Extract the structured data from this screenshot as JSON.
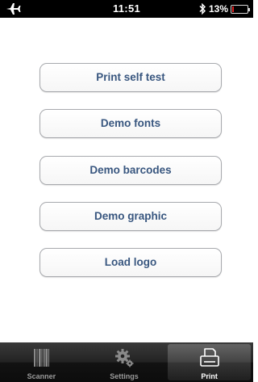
{
  "status_bar": {
    "time": "11:51",
    "battery_percent": "13%",
    "icons": [
      "airplane-icon",
      "bluetooth-icon",
      "battery-icon"
    ],
    "battery_level": 0.13
  },
  "buttons": [
    {
      "label": "Print self test"
    },
    {
      "label": "Demo fonts"
    },
    {
      "label": "Demo barcodes"
    },
    {
      "label": "Demo graphic"
    },
    {
      "label": "Load logo"
    }
  ],
  "tab_bar": {
    "tabs": [
      {
        "label": "Scanner",
        "icon": "barcode-icon",
        "selected": false
      },
      {
        "label": "Settings",
        "icon": "gear-icon",
        "selected": false
      },
      {
        "label": "Print",
        "icon": "printer-icon",
        "selected": true
      }
    ]
  },
  "colors": {
    "button_text": "#38567f",
    "button_border": "#a7a9ad",
    "status_bar_bg": "#000000",
    "battery_low": "#e02020"
  }
}
